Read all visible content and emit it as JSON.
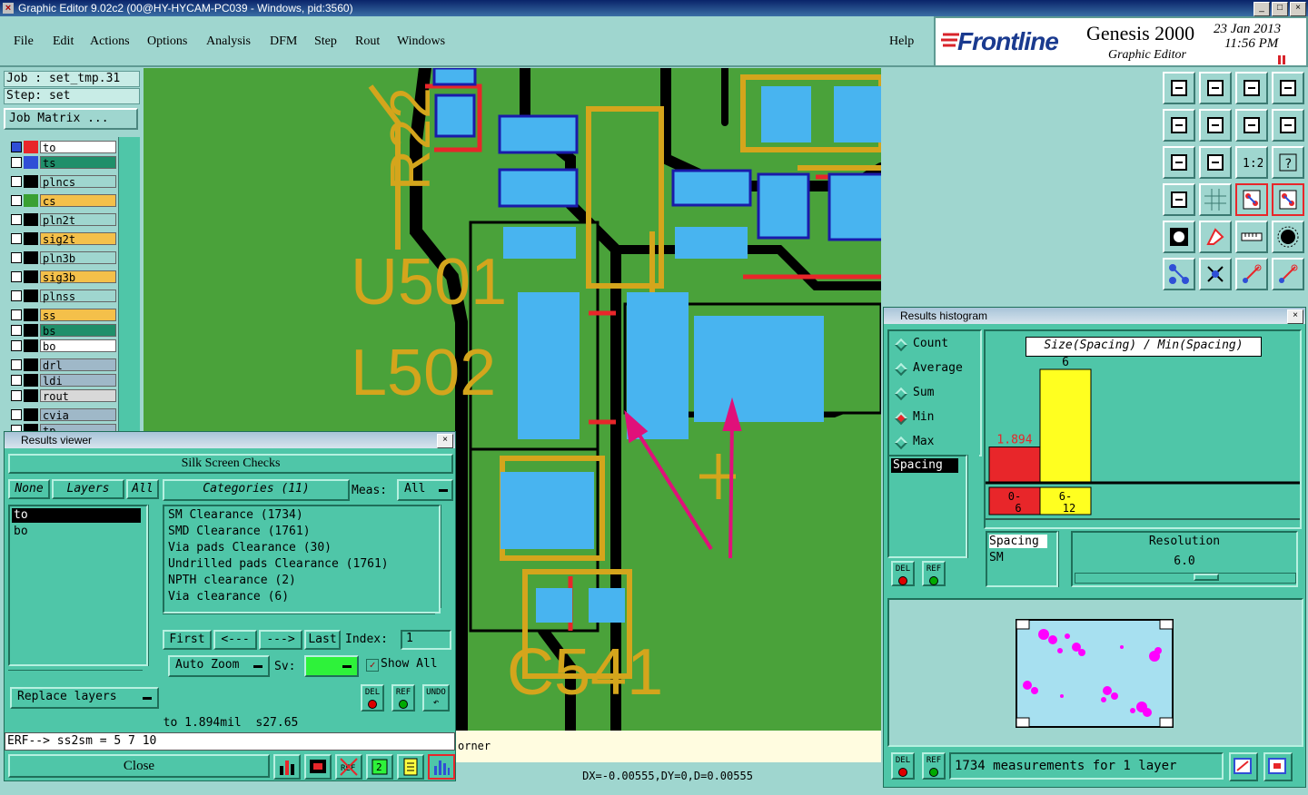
{
  "window": {
    "title": "Graphic Editor 9.02c2 (00@HY-HYCAM-PC039 - Windows, pid:3560)"
  },
  "menu": {
    "items": [
      "File",
      "Edit",
      "Actions",
      "Options",
      "Analysis",
      "DFM",
      "Step",
      "Rout",
      "Windows"
    ],
    "help": "Help"
  },
  "brand": {
    "logo": "Frontline",
    "product": "Genesis 2000",
    "subtitle": "Graphic Editor",
    "date": "23 Jan 2013",
    "time": "11:56 PM"
  },
  "job": {
    "job_label": "Job : set_tmp.31",
    "step_label": "Step: set",
    "matrix_button": "Job Matrix ..."
  },
  "layers": [
    {
      "name": "to",
      "color": "#ffffff",
      "swatch": "#e8262a"
    },
    {
      "name": "ts",
      "color": "#1f8f6a",
      "swatch": "#2f4fd6"
    },
    {
      "name": "plncs",
      "color": "#9fd6cf",
      "swatch": "#000000"
    },
    {
      "name": "cs",
      "color": "#f4c04a",
      "swatch": "#3aa032"
    },
    {
      "name": "pln2t",
      "color": "#9fd6cf",
      "swatch": "#000000"
    },
    {
      "name": "sig2t",
      "color": "#f4c04a",
      "swatch": "#000000"
    },
    {
      "name": "pln3b",
      "color": "#9fd6cf",
      "swatch": "#000000"
    },
    {
      "name": "sig3b",
      "color": "#f4c04a",
      "swatch": "#000000"
    },
    {
      "name": "plnss",
      "color": "#9fd6cf",
      "swatch": "#000000"
    },
    {
      "name": "ss",
      "color": "#f4c04a",
      "swatch": "#000000"
    },
    {
      "name": "bs",
      "color": "#1f8f6a",
      "swatch": "#000000"
    },
    {
      "name": "bo",
      "color": "#ffffff",
      "swatch": "#000000"
    },
    {
      "name": "drl",
      "color": "#9fb8c8",
      "swatch": "#000000"
    },
    {
      "name": "ldi",
      "color": "#9fb8c8",
      "swatch": "#000000"
    },
    {
      "name": "rout",
      "color": "#d8d8d8",
      "swatch": "#000000"
    },
    {
      "name": "cvia",
      "color": "#9fb8c8",
      "swatch": "#000000"
    },
    {
      "name": "tp",
      "color": "#9fb8c8",
      "swatch": "#000000"
    }
  ],
  "canvas": {
    "silk_labels": [
      "R22",
      "U501",
      "L502",
      "C541"
    ],
    "status_text": "orner",
    "coords": "DX=-0.00555,DY=0,D=0.00555"
  },
  "results_viewer": {
    "title": "Results viewer",
    "header": "Silk Screen Checks",
    "none_label": "None",
    "layers_label": "Layers",
    "all_label": "All",
    "layer_list": [
      "to",
      "bo"
    ],
    "categories_label": "Categories (11)",
    "meas_label": "Meas:",
    "meas_value": "All",
    "categories": [
      "SM Clearance (1734)",
      "SMD Clearance (1761)",
      "Via pads Clearance (30)",
      "Undrilled pads Clearance (1761)",
      "NPTH clearance (2)",
      "Via clearance (6)"
    ],
    "first": "First",
    "prev": "<---",
    "next": "--->",
    "last": "Last",
    "index_label": "Index:",
    "index_value": "1",
    "auto_zoom": "Auto Zoom",
    "sv_label": "Sv:",
    "show_all": "Show All",
    "replace_layers": "Replace layers",
    "del": "DEL",
    "ref": "REF",
    "undo": "UNDO",
    "status": "to 1.894mil  s27.65",
    "erf": "ERF--> ss2sm = 5 7 10",
    "close": "Close"
  },
  "histogram": {
    "title": "Results histogram",
    "modes": [
      "Count",
      "Average",
      "Sum",
      "Min",
      "Max"
    ],
    "selected_mode": "Min",
    "list_item": "Spacing",
    "chart_title": "Size(Spacing) / Min(Spacing)",
    "resolution_label": "Resolution",
    "resolution_value": "6.0",
    "spacing_label": "Spacing",
    "spacing_sub": "SM",
    "del": "DEL",
    "ref": "REF",
    "measurements": "1734 measurements for 1 layer",
    "bar_colors": [
      "#e8262a",
      "#ffff20"
    ]
  },
  "chart_data": {
    "type": "bar",
    "title": "Size(Spacing) / Min(Spacing)",
    "categories": [
      "0-6",
      "6-12"
    ],
    "values": [
      1.894,
      6
    ],
    "data_labels": [
      "1.894",
      "6"
    ],
    "ylim": [
      0,
      6
    ]
  }
}
